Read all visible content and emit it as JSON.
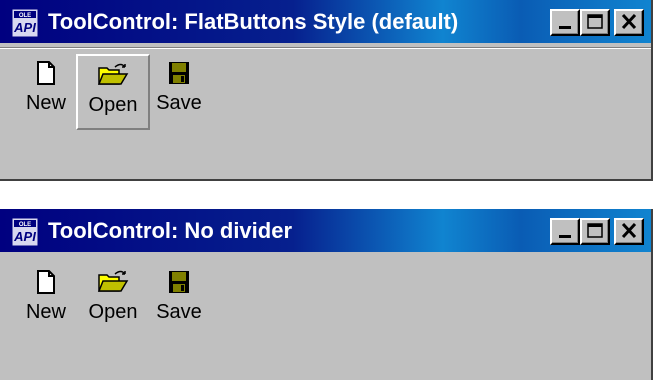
{
  "windows": [
    {
      "title": "ToolControl: FlatButtons Style (default)",
      "show_divider": true,
      "toolbar": [
        {
          "label": "New",
          "icon": "new-document-icon",
          "hot": false
        },
        {
          "label": "Open",
          "icon": "open-folder-icon",
          "hot": true
        },
        {
          "label": "Save",
          "icon": "save-disk-icon",
          "hot": false
        }
      ]
    },
    {
      "title": "ToolControl: No divider",
      "show_divider": false,
      "toolbar": [
        {
          "label": "New",
          "icon": "new-document-icon",
          "hot": false
        },
        {
          "label": "Open",
          "icon": "open-folder-icon",
          "hot": false
        },
        {
          "label": "Save",
          "icon": "save-disk-icon",
          "hot": false
        }
      ]
    }
  ],
  "app_icon_text": "OLE API",
  "colors": {
    "titlebar_start": "#000080",
    "titlebar_end": "#1084d0",
    "face": "#c0c0c0",
    "title_text": "#ffffff"
  }
}
